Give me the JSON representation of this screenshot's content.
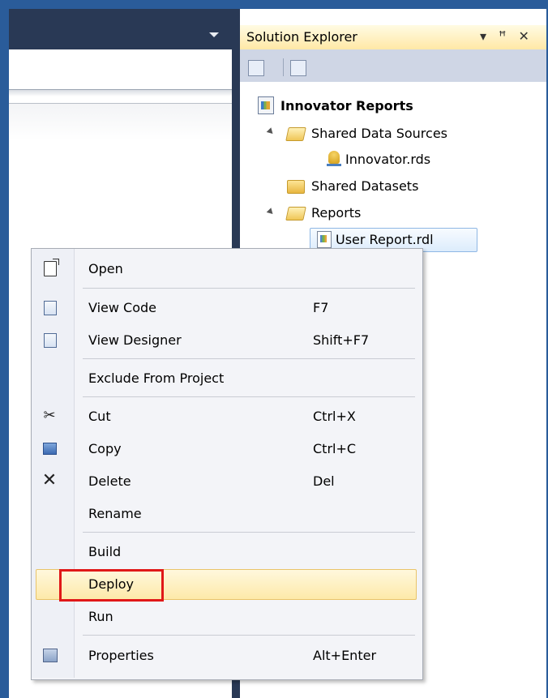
{
  "solution_explorer": {
    "title": "Solution Explorer",
    "controls": {
      "dropdown": "▾",
      "pin": "ꟸ",
      "close": "✕"
    },
    "tree": {
      "project": "Innovator Reports",
      "shared_data_sources": "Shared Data Sources",
      "data_source_file": "Innovator.rds",
      "shared_datasets": "Shared Datasets",
      "reports": "Reports",
      "report_file": "User Report.rdl"
    }
  },
  "context_menu": {
    "items": [
      {
        "label": "Open",
        "shortcut": "",
        "icon": "open-document-icon"
      },
      {
        "label": "View Code",
        "shortcut": "F7",
        "icon": "view-code-icon"
      },
      {
        "label": "View Designer",
        "shortcut": "Shift+F7",
        "icon": "view-designer-icon"
      },
      {
        "label": "Exclude From Project",
        "shortcut": "",
        "icon": ""
      },
      {
        "label": "Cut",
        "shortcut": "Ctrl+X",
        "icon": "scissors-icon"
      },
      {
        "label": "Copy",
        "shortcut": "Ctrl+C",
        "icon": "copy-icon"
      },
      {
        "label": "Delete",
        "shortcut": "Del",
        "icon": "delete-x-icon"
      },
      {
        "label": "Rename",
        "shortcut": "",
        "icon": ""
      },
      {
        "label": "Build",
        "shortcut": "",
        "icon": ""
      },
      {
        "label": "Deploy",
        "shortcut": "",
        "icon": ""
      },
      {
        "label": "Run",
        "shortcut": "",
        "icon": ""
      },
      {
        "label": "Properties",
        "shortcut": "Alt+Enter",
        "icon": "properties-icon"
      }
    ],
    "highlighted_item": "Deploy"
  },
  "colors": {
    "frame_blue": "#2a5c9a",
    "dark_header": "#293955",
    "highlight_red": "#e01818",
    "hover_yellow": "#fde9a9"
  }
}
